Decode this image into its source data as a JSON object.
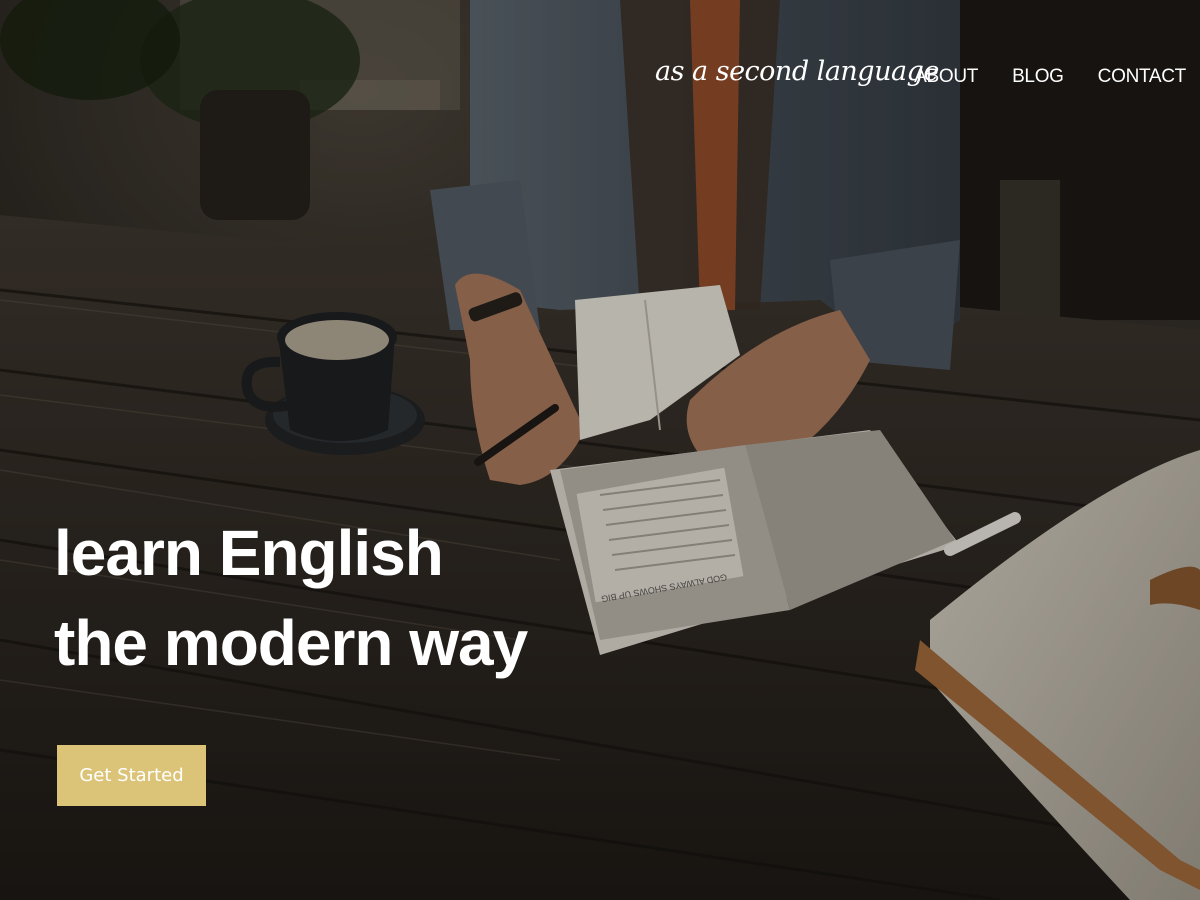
{
  "header": {
    "brand": "as a second language",
    "nav": [
      {
        "label": "ABOUT"
      },
      {
        "label": "BLOG"
      },
      {
        "label": "CONTACT"
      }
    ]
  },
  "hero": {
    "headline_line1": "learn English",
    "headline_line2": "the modern way",
    "cta_label": "Get Started"
  },
  "book": {
    "page_heading": "GOD ALWAYS SHOWS UP BIG"
  },
  "colors": {
    "cta_background": "#dbc477",
    "text": "#ffffff"
  }
}
